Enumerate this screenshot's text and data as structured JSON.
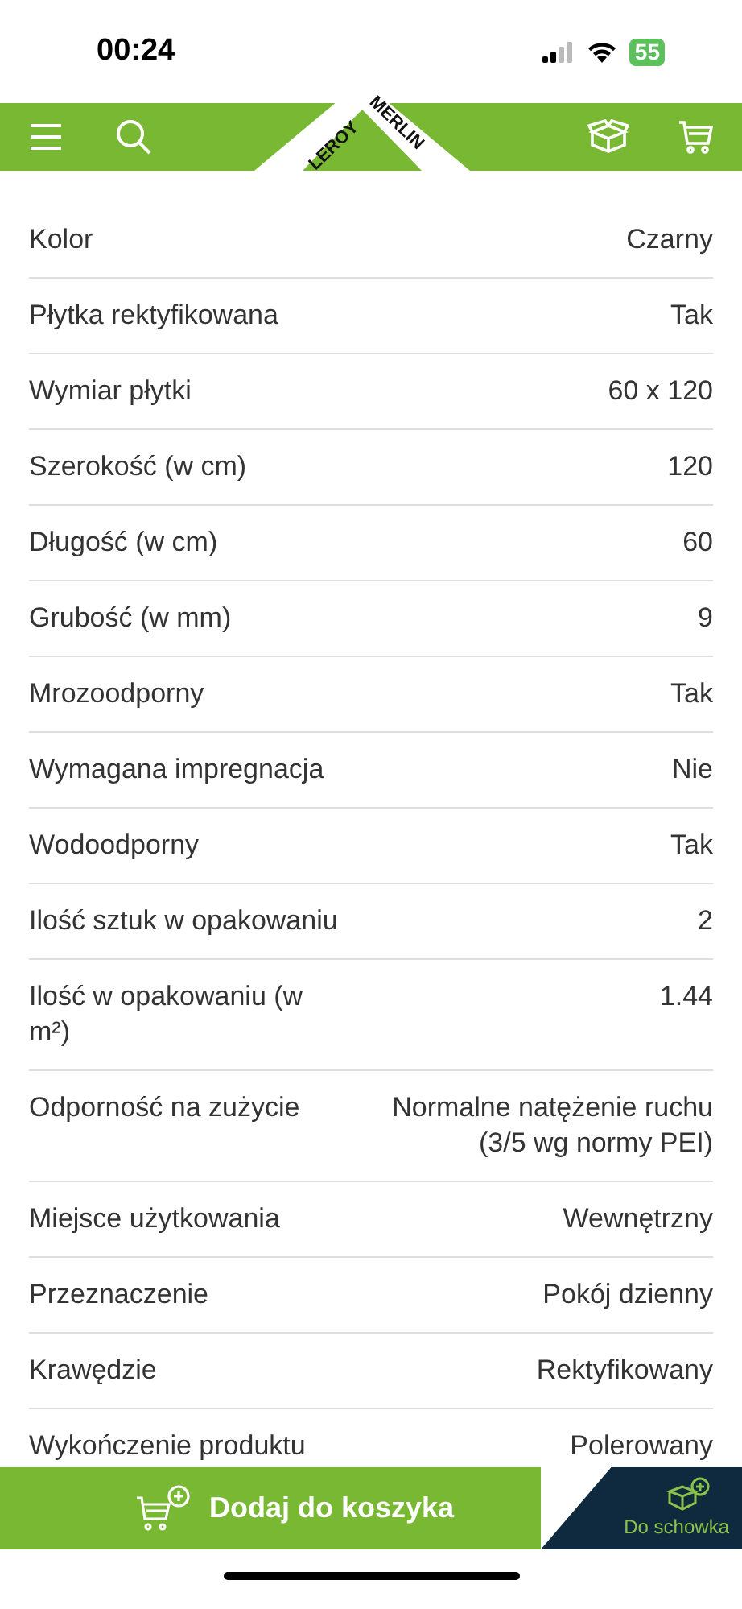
{
  "status_bar": {
    "time": "00:24",
    "battery": "55"
  },
  "header": {
    "logo": [
      "LEROY",
      "MERLIN"
    ]
  },
  "specs": [
    {
      "label": "Kolor",
      "value": "Czarny"
    },
    {
      "label": "Płytka rektyfikowana",
      "value": "Tak"
    },
    {
      "label": "Wymiar płytki",
      "value": "60 x 120"
    },
    {
      "label": "Szerokość (w cm)",
      "value": "120"
    },
    {
      "label": "Długość (w cm)",
      "value": "60"
    },
    {
      "label": "Grubość (w mm)",
      "value": "9"
    },
    {
      "label": "Mrozoodporny",
      "value": "Tak"
    },
    {
      "label": "Wymagana impregnacja",
      "value": "Nie"
    },
    {
      "label": "Wodoodporny",
      "value": "Tak"
    },
    {
      "label": "Ilość sztuk w opakowaniu",
      "value": "2"
    },
    {
      "label": "Ilość w opakowaniu (w m²)",
      "value": "1.44"
    },
    {
      "label": "Odporność na zużycie",
      "value": "Normalne natężenie ruchu (3/5 wg normy PEI)"
    },
    {
      "label": "Miejsce użytkowania",
      "value": "Wewnętrzny"
    },
    {
      "label": "Przeznaczenie",
      "value": "Pokój dzienny"
    },
    {
      "label": "Krawędzie",
      "value": "Rektyfikowany"
    },
    {
      "label": "Wykończenie produktu",
      "value": "Polerowany"
    }
  ],
  "actions": {
    "add_to_cart": "Dodaj do koszyka",
    "save": "Do schowka"
  }
}
